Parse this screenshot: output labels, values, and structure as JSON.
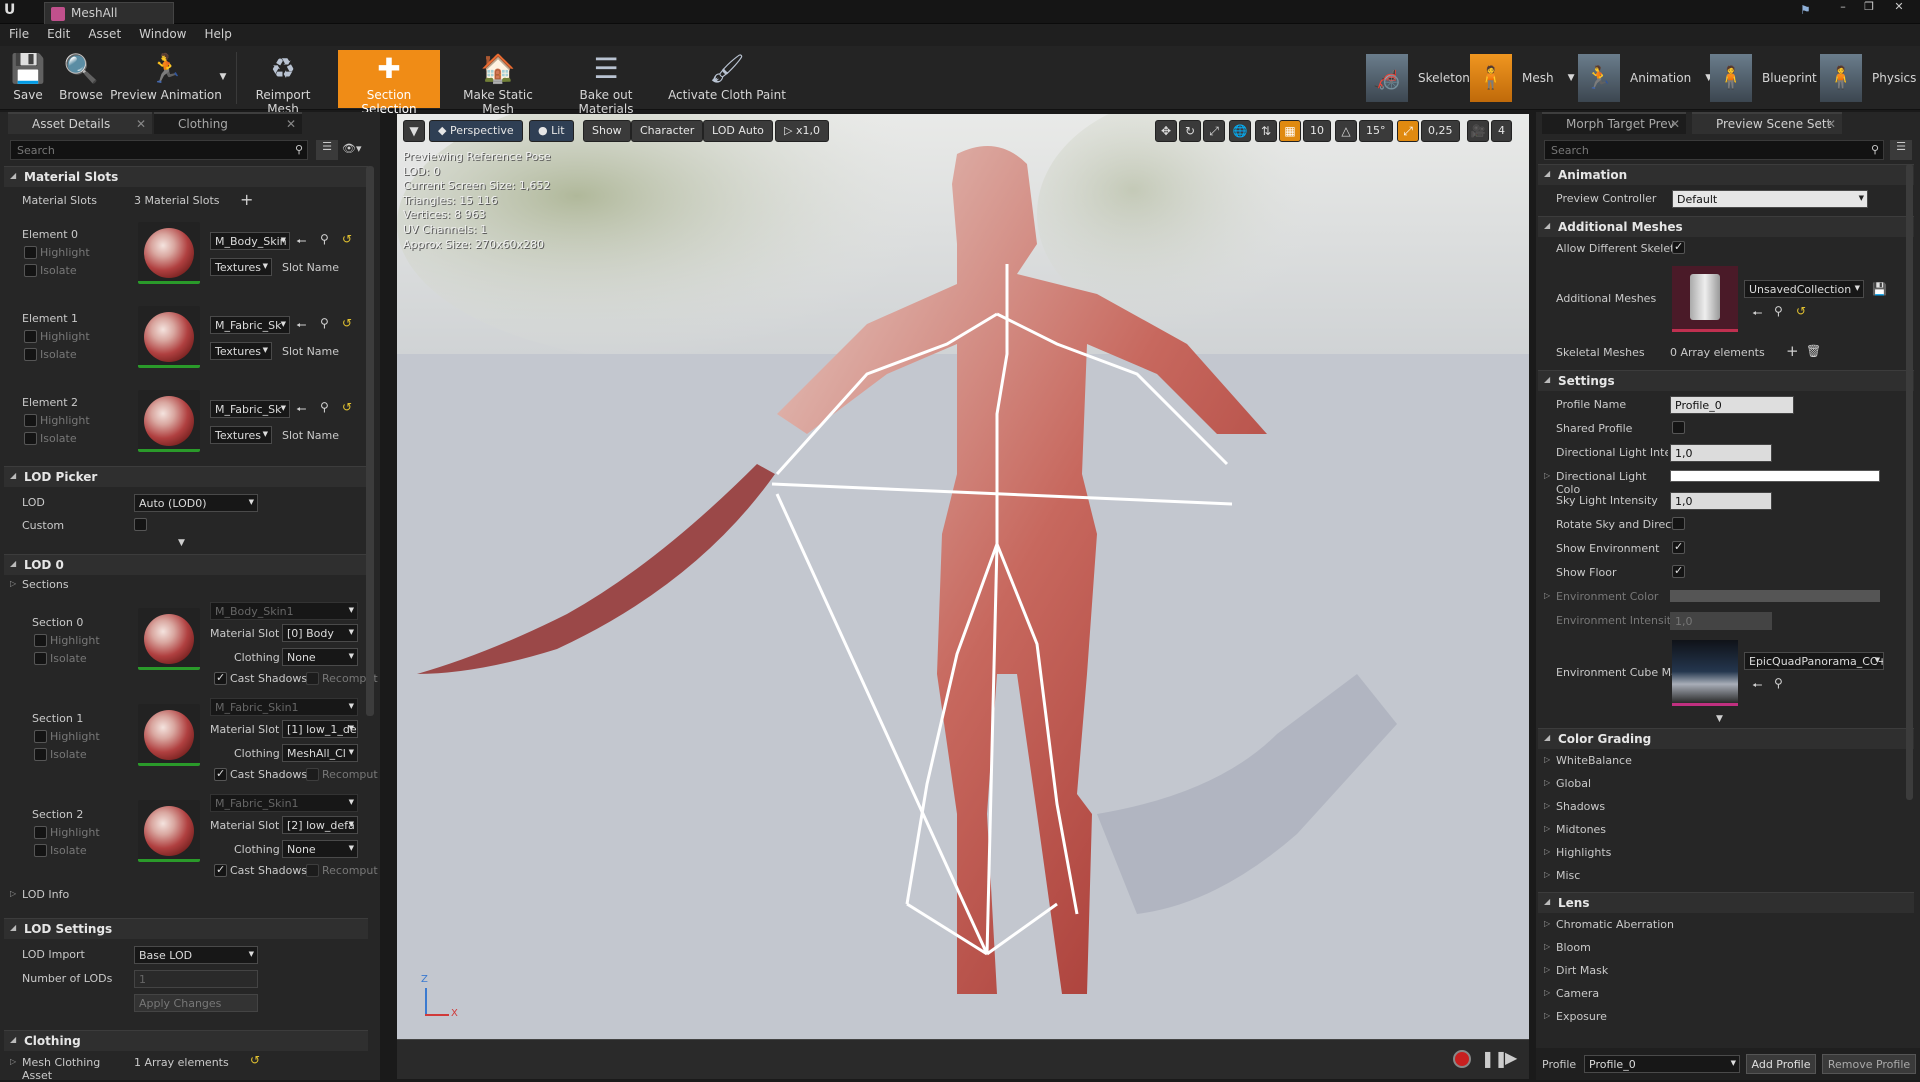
{
  "window": {
    "tab_title": "MeshAll"
  },
  "menu": [
    "File",
    "Edit",
    "Asset",
    "Window",
    "Help"
  ],
  "toolbar": {
    "buttons": [
      {
        "label": "Save",
        "icon": "save-icon"
      },
      {
        "label": "Browse",
        "icon": "browse-icon"
      },
      {
        "label": "Preview Animation",
        "icon": "preview-animation-icon"
      },
      {
        "label": "Reimport Mesh",
        "icon": "reimport-icon"
      },
      {
        "label": "Section Selection",
        "icon": "section-selection-icon",
        "active": true
      },
      {
        "label": "Make Static Mesh",
        "icon": "make-static-mesh-icon"
      },
      {
        "label": "Bake out Materials",
        "icon": "bake-materials-icon"
      },
      {
        "label": "Activate Cloth Paint",
        "icon": "cloth-paint-icon"
      }
    ],
    "modes": [
      {
        "label": "Skeleton",
        "active": false
      },
      {
        "label": "Mesh",
        "active": true
      },
      {
        "label": "Animation",
        "active": false
      },
      {
        "label": "Blueprint",
        "active": false
      },
      {
        "label": "Physics",
        "active": false
      }
    ]
  },
  "left_panel": {
    "tabs": [
      "Asset Details",
      "Clothing"
    ],
    "search_placeholder": "Search",
    "material_slots": {
      "header": "Material Slots",
      "label": "Material Slots",
      "count_text": "3 Material Slots",
      "elements": [
        {
          "label": "Element 0",
          "material": "M_Body_Skin",
          "textures": "Textures",
          "slot_name": "Slot Name"
        },
        {
          "label": "Element 1",
          "material": "M_Fabric_Sk",
          "textures": "Textures",
          "slot_name": "Slot Name"
        },
        {
          "label": "Element 2",
          "material": "M_Fabric_Sk",
          "textures": "Textures",
          "slot_name": "Slot Name"
        }
      ],
      "highlight": "Highlight",
      "isolate": "Isolate"
    },
    "lod_picker": {
      "header": "LOD Picker",
      "lod_label": "LOD",
      "lod_value": "Auto (LOD0)",
      "custom_label": "Custom"
    },
    "lod0": {
      "header": "LOD 0",
      "sections_label": "Sections",
      "sections": [
        {
          "label": "Section 0",
          "material": "M_Body_Skin1",
          "material_slot": "[0] Body",
          "clothing": "None"
        },
        {
          "label": "Section 1",
          "material": "M_Fabric_Skin1",
          "material_slot": "[1] low_1_de",
          "clothing": "MeshAll_Cl"
        },
        {
          "label": "Section 2",
          "material": "M_Fabric_Skin1",
          "material_slot": "[2] low_defa",
          "clothing": "None"
        }
      ],
      "material_slot_label": "Material Slot",
      "clothing_label": "Clothing",
      "cast_shadows": "Cast Shadows",
      "recompute": "Recompute",
      "lod_info": "LOD Info"
    },
    "lod_settings": {
      "header": "LOD Settings",
      "lod_import_label": "LOD Import",
      "lod_import_value": "Base LOD",
      "num_lods_label": "Number of LODs",
      "num_lods_value": "1",
      "apply_label": "Apply Changes"
    },
    "clothing": {
      "header": "Clothing",
      "asset_label": "Mesh Clothing Asset",
      "asset_value": "1 Array elements"
    }
  },
  "viewport": {
    "buttons": {
      "perspective": "Perspective",
      "lit": "Lit",
      "show": "Show",
      "character": "Character",
      "lod": "LOD Auto",
      "speed": "x1,0"
    },
    "snap": {
      "grid": "10",
      "angle": "15°",
      "scale": "0,25",
      "camera": "4"
    },
    "stats": [
      "Previewing Reference Pose",
      "LOD: 0",
      "Current Screen Size: 1,652",
      "Triangles: 15 116",
      "Vertices: 8 963",
      "UV Channels: 1",
      "Approx Size: 270x60x280"
    ],
    "axis": {
      "x": "X",
      "z": "Z"
    }
  },
  "right_panel": {
    "tabs": [
      "Morph Target Prev",
      "Preview Scene Sett"
    ],
    "search_placeholder": "Search",
    "animation": {
      "header": "Animation",
      "controller_label": "Preview Controller",
      "controller_value": "Default"
    },
    "additional_meshes": {
      "header": "Additional Meshes",
      "allow_label": "Allow Different Skelet",
      "meshes_label": "Additional Meshes",
      "collection": "UnsavedCollection",
      "skeletal_label": "Skeletal Meshes",
      "skeletal_value": "0 Array elements"
    },
    "settings": {
      "header": "Settings",
      "profile_name_label": "Profile Name",
      "profile_name_value": "Profile_0",
      "shared_profile_label": "Shared Profile",
      "dir_light_int_label": "Directional Light Inter",
      "dir_light_int_value": "1,0",
      "dir_light_color_label": "Directional Light Colo",
      "sky_light_label": "Sky Light Intensity",
      "sky_light_value": "1,0",
      "rotate_label": "Rotate Sky and Direct",
      "show_env_label": "Show Environment",
      "show_floor_label": "Show Floor",
      "env_color_label": "Environment Color",
      "env_intensity_label": "Environment Intensity",
      "env_intensity_value": "1,0",
      "env_cube_label": "Environment Cube Ma",
      "env_cube_value": "EpicQuadPanorama_CC+E"
    },
    "color_grading": {
      "header": "Color Grading",
      "items": [
        "WhiteBalance",
        "Global",
        "Shadows",
        "Midtones",
        "Highlights",
        "Misc"
      ]
    },
    "lens": {
      "header": "Lens",
      "items": [
        "Chromatic Aberration",
        "Bloom",
        "Dirt Mask",
        "Camera",
        "Exposure"
      ]
    },
    "footer": {
      "profile_label": "Profile",
      "profile_value": "Profile_0",
      "add": "Add Profile",
      "remove": "Remove Profile"
    }
  },
  "colors": {
    "accent": "#f08c16",
    "panel": "#262626",
    "viewport_floor": "#c6c9cf"
  }
}
